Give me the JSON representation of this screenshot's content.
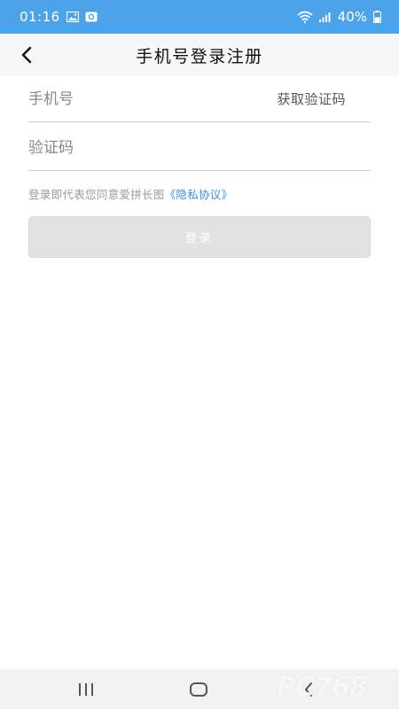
{
  "status_bar": {
    "time": "01:16",
    "battery": "40%",
    "icons": [
      "image-icon",
      "app-notification-icon",
      "wifi-icon",
      "signal-icon",
      "battery-icon"
    ]
  },
  "header": {
    "title": "手机号登录注册",
    "back_icon": "back-arrow-icon"
  },
  "form": {
    "phone_placeholder": "手机号",
    "get_code_label": "获取验证码",
    "code_placeholder": "验证码",
    "agreement_text": "登录即代表您同意爱拼长图",
    "agreement_link": "《隐私协议》",
    "login_label": "登录"
  },
  "nav_bar": {
    "icons": [
      "recents-icon",
      "home-icon",
      "back-icon"
    ]
  },
  "watermark": "PC768",
  "colors": {
    "status_bar": "#4da3e8",
    "header_bg": "#f7f7f7",
    "link": "#3d8fde",
    "button_disabled": "#e2e2e2"
  }
}
